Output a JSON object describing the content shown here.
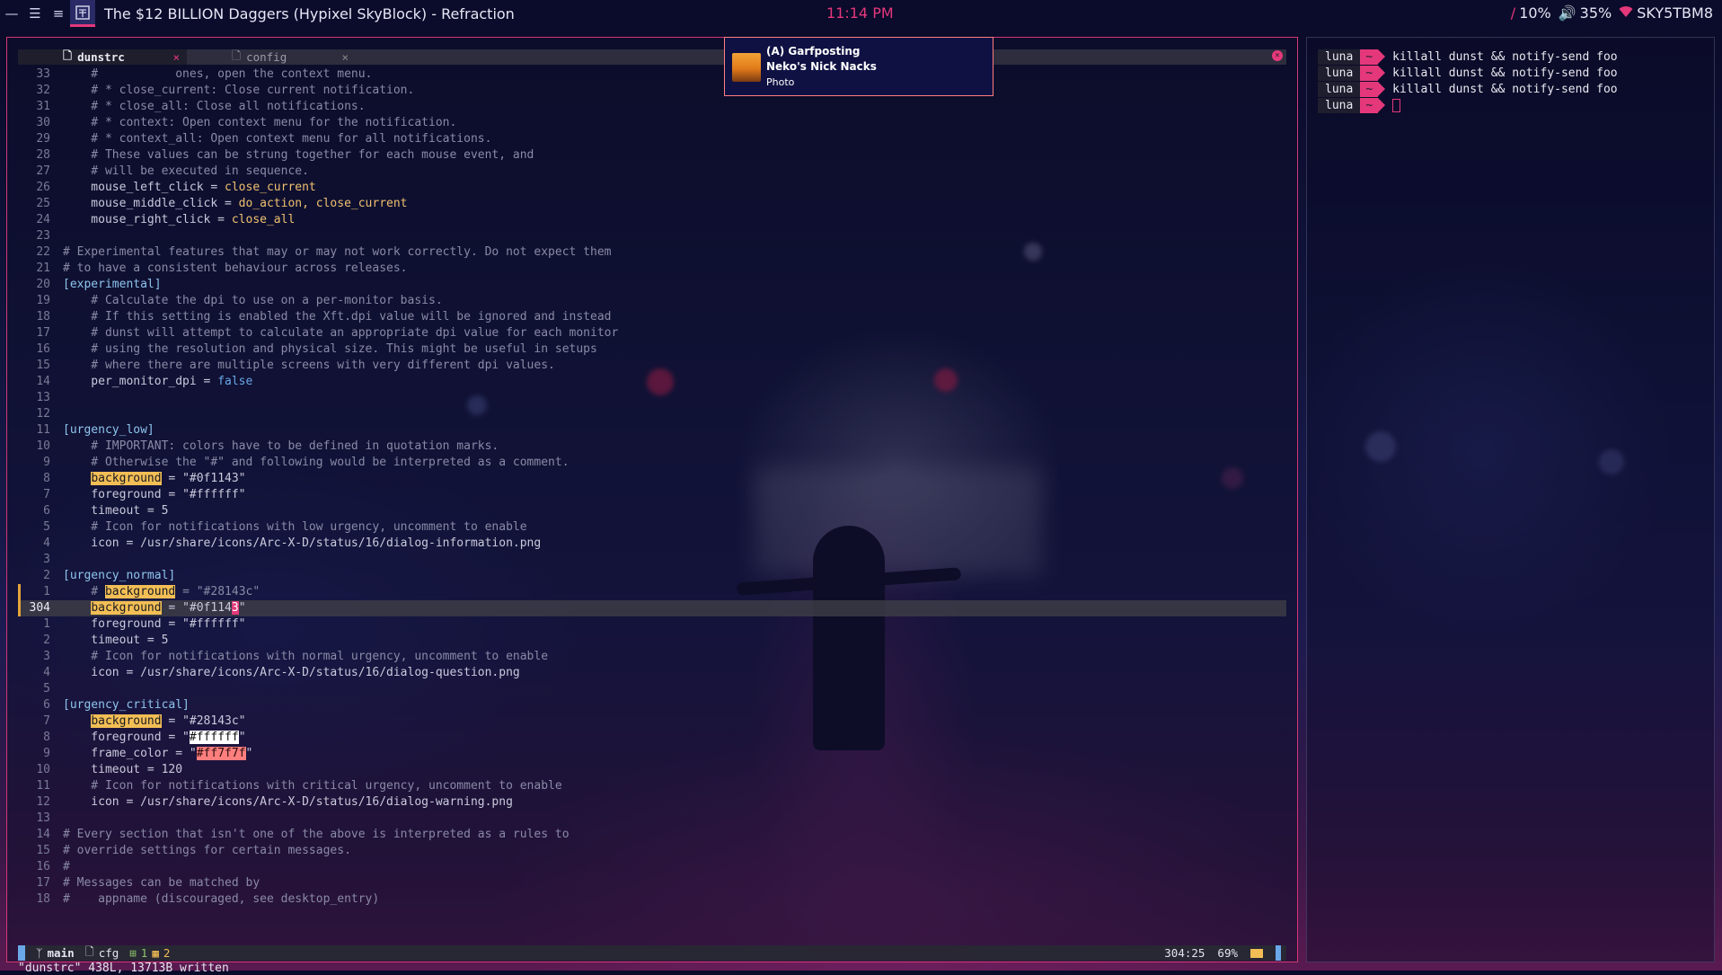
{
  "topbar": {
    "window_title": "The $12 BILLION Daggers (Hypixel SkyBlock) - Refraction",
    "clock": "11:14 PM",
    "cpu": "10%",
    "volume": "35%",
    "wifi_ssid": "SKY5TBM8",
    "icons": [
      "minimize-icon",
      "layout-icon",
      "menu-icon",
      "workspace-icon"
    ]
  },
  "editor": {
    "tabs": [
      {
        "label": "dunstrc",
        "active": true
      },
      {
        "label": "config",
        "active": false
      }
    ],
    "lines": [
      {
        "n": "33",
        "t": "    #           ones, open the context menu.",
        "c": "cm"
      },
      {
        "n": "32",
        "t": "    # * close_current: Close current notification.",
        "c": "cm"
      },
      {
        "n": "31",
        "t": "    # * close_all: Close all notifications.",
        "c": "cm"
      },
      {
        "n": "30",
        "t": "    # * context: Open context menu for the notification.",
        "c": "cm"
      },
      {
        "n": "29",
        "t": "    # * context_all: Open context menu for all notifications.",
        "c": "cm"
      },
      {
        "n": "28",
        "t": "    # These values can be strung together for each mouse event, and",
        "c": "cm"
      },
      {
        "n": "27",
        "t": "    # will be executed in sequence.",
        "c": "cm"
      },
      {
        "n": "26",
        "k": "    mouse_left_click = ",
        "v": "close_current"
      },
      {
        "n": "25",
        "k": "    mouse_middle_click = ",
        "v": "do_action, close_current"
      },
      {
        "n": "24",
        "k": "    mouse_right_click = ",
        "v": "close_all"
      },
      {
        "n": "23",
        "t": ""
      },
      {
        "n": "22",
        "t": "# Experimental features that may or may not work correctly. Do not expect them",
        "c": "cm"
      },
      {
        "n": "21",
        "t": "# to have a consistent behaviour across releases.",
        "c": "cm"
      },
      {
        "n": "20",
        "t": "[experimental]",
        "c": "sec"
      },
      {
        "n": "19",
        "t": "    # Calculate the dpi to use on a per-monitor basis.",
        "c": "cm"
      },
      {
        "n": "18",
        "t": "    # If this setting is enabled the Xft.dpi value will be ignored and instead",
        "c": "cm"
      },
      {
        "n": "17",
        "t": "    # dunst will attempt to calculate an appropriate dpi value for each monitor",
        "c": "cm"
      },
      {
        "n": "16",
        "t": "    # using the resolution and physical size. This might be useful in setups",
        "c": "cm"
      },
      {
        "n": "15",
        "t": "    # where there are multiple screens with very different dpi values.",
        "c": "cm"
      },
      {
        "n": "14",
        "k": "    per_monitor_dpi = ",
        "v": "false",
        "vc": "bool"
      },
      {
        "n": "13",
        "t": ""
      },
      {
        "n": "12",
        "t": ""
      },
      {
        "n": "11",
        "t": "[urgency_low]",
        "c": "sec"
      },
      {
        "n": "10",
        "t": "    # IMPORTANT: colors have to be defined in quotation marks.",
        "c": "cm"
      },
      {
        "n": "9",
        "t": "    # Otherwise the \"#\" and following would be interpreted as a comment.",
        "c": "cm"
      },
      {
        "n": "8",
        "pre": "    ",
        "h": "background",
        "hc": "hl",
        "post": " = \"#0f1143\""
      },
      {
        "n": "7",
        "pre": "    ",
        "h": "foreground",
        "hc": "",
        "post": " = \"#ffffff\""
      },
      {
        "n": "6",
        "t": "    timeout = 5"
      },
      {
        "n": "5",
        "t": "    # Icon for notifications with low urgency, uncomment to enable",
        "c": "cm"
      },
      {
        "n": "4",
        "t": "    icon = /usr/share/icons/Arc-X-D/status/16/dialog-information.png"
      },
      {
        "n": "3",
        "t": ""
      },
      {
        "n": "2",
        "t": "[urgency_normal]",
        "c": "sec"
      },
      {
        "n": "1",
        "pre": "    # ",
        "h": "background",
        "hc": "hl",
        "post": " = \"#28143c\"",
        "c": "cm",
        "gm": true
      },
      {
        "n": "304",
        "pre": "    ",
        "h": "background",
        "hc": "hl",
        "post": " = \"#0f114",
        "cur": "3",
        "post2": "\"",
        "current": true
      },
      {
        "n": "1",
        "t": "    foreground = \"#ffffff\""
      },
      {
        "n": "2",
        "t": "    timeout = 5"
      },
      {
        "n": "3",
        "t": "    # Icon for notifications with normal urgency, uncomment to enable",
        "c": "cm"
      },
      {
        "n": "4",
        "t": "    icon = /usr/share/icons/Arc-X-D/status/16/dialog-question.png"
      },
      {
        "n": "5",
        "t": ""
      },
      {
        "n": "6",
        "t": "[urgency_critical]",
        "c": "sec"
      },
      {
        "n": "7",
        "pre": "    ",
        "h": "background",
        "hc": "hl",
        "post": " = \"#28143c\""
      },
      {
        "n": "8",
        "pre": "    foreground = \"",
        "h": "#ffffff",
        "hc": "hl-w",
        "post": "\""
      },
      {
        "n": "9",
        "pre": "    frame_color = \"",
        "h": "#ff7f7f",
        "hc": "hl-r",
        "post": "\""
      },
      {
        "n": "10",
        "t": "    timeout = 120"
      },
      {
        "n": "11",
        "t": "    # Icon for notifications with critical urgency, uncomment to enable",
        "c": "cm"
      },
      {
        "n": "12",
        "t": "    icon = /usr/share/icons/Arc-X-D/status/16/dialog-warning.png"
      },
      {
        "n": "13",
        "t": ""
      },
      {
        "n": "14",
        "t": "# Every section that isn't one of the above is interpreted as a rules to",
        "c": "cm"
      },
      {
        "n": "15",
        "t": "# override settings for certain messages.",
        "c": "cm"
      },
      {
        "n": "16",
        "t": "#",
        "c": "cm"
      },
      {
        "n": "17",
        "t": "# Messages can be matched by",
        "c": "cm"
      },
      {
        "n": "18",
        "t": "#    appname (discouraged, see desktop_entry)",
        "c": "cm"
      }
    ],
    "statusline": {
      "branch": "main",
      "filetype": "cfg",
      "diag_errors": "1",
      "diag_warnings": "2",
      "position": "304:25",
      "percent": "69%"
    },
    "message": "\"dunstrc\" 438L, 13713B written"
  },
  "notification": {
    "app": "(A) Garfposting",
    "summary": "Neko's Nick Nacks",
    "body": "Photo"
  },
  "terminal": {
    "lines": [
      {
        "user": "luna",
        "dir": "~",
        "cmd": "killall dunst && notify-send foo"
      },
      {
        "user": "luna",
        "dir": "~",
        "cmd": "killall dunst && notify-send foo"
      },
      {
        "user": "luna",
        "dir": "~",
        "cmd": "killall dunst && notify-send foo"
      },
      {
        "user": "luna",
        "dir": "~",
        "cmd": ""
      }
    ]
  },
  "colors": {
    "accent": "#e4387b",
    "bar_bg": "#0b0b2b",
    "notif_bg": "#0f1143",
    "notif_frame": "#ff7f7f"
  }
}
